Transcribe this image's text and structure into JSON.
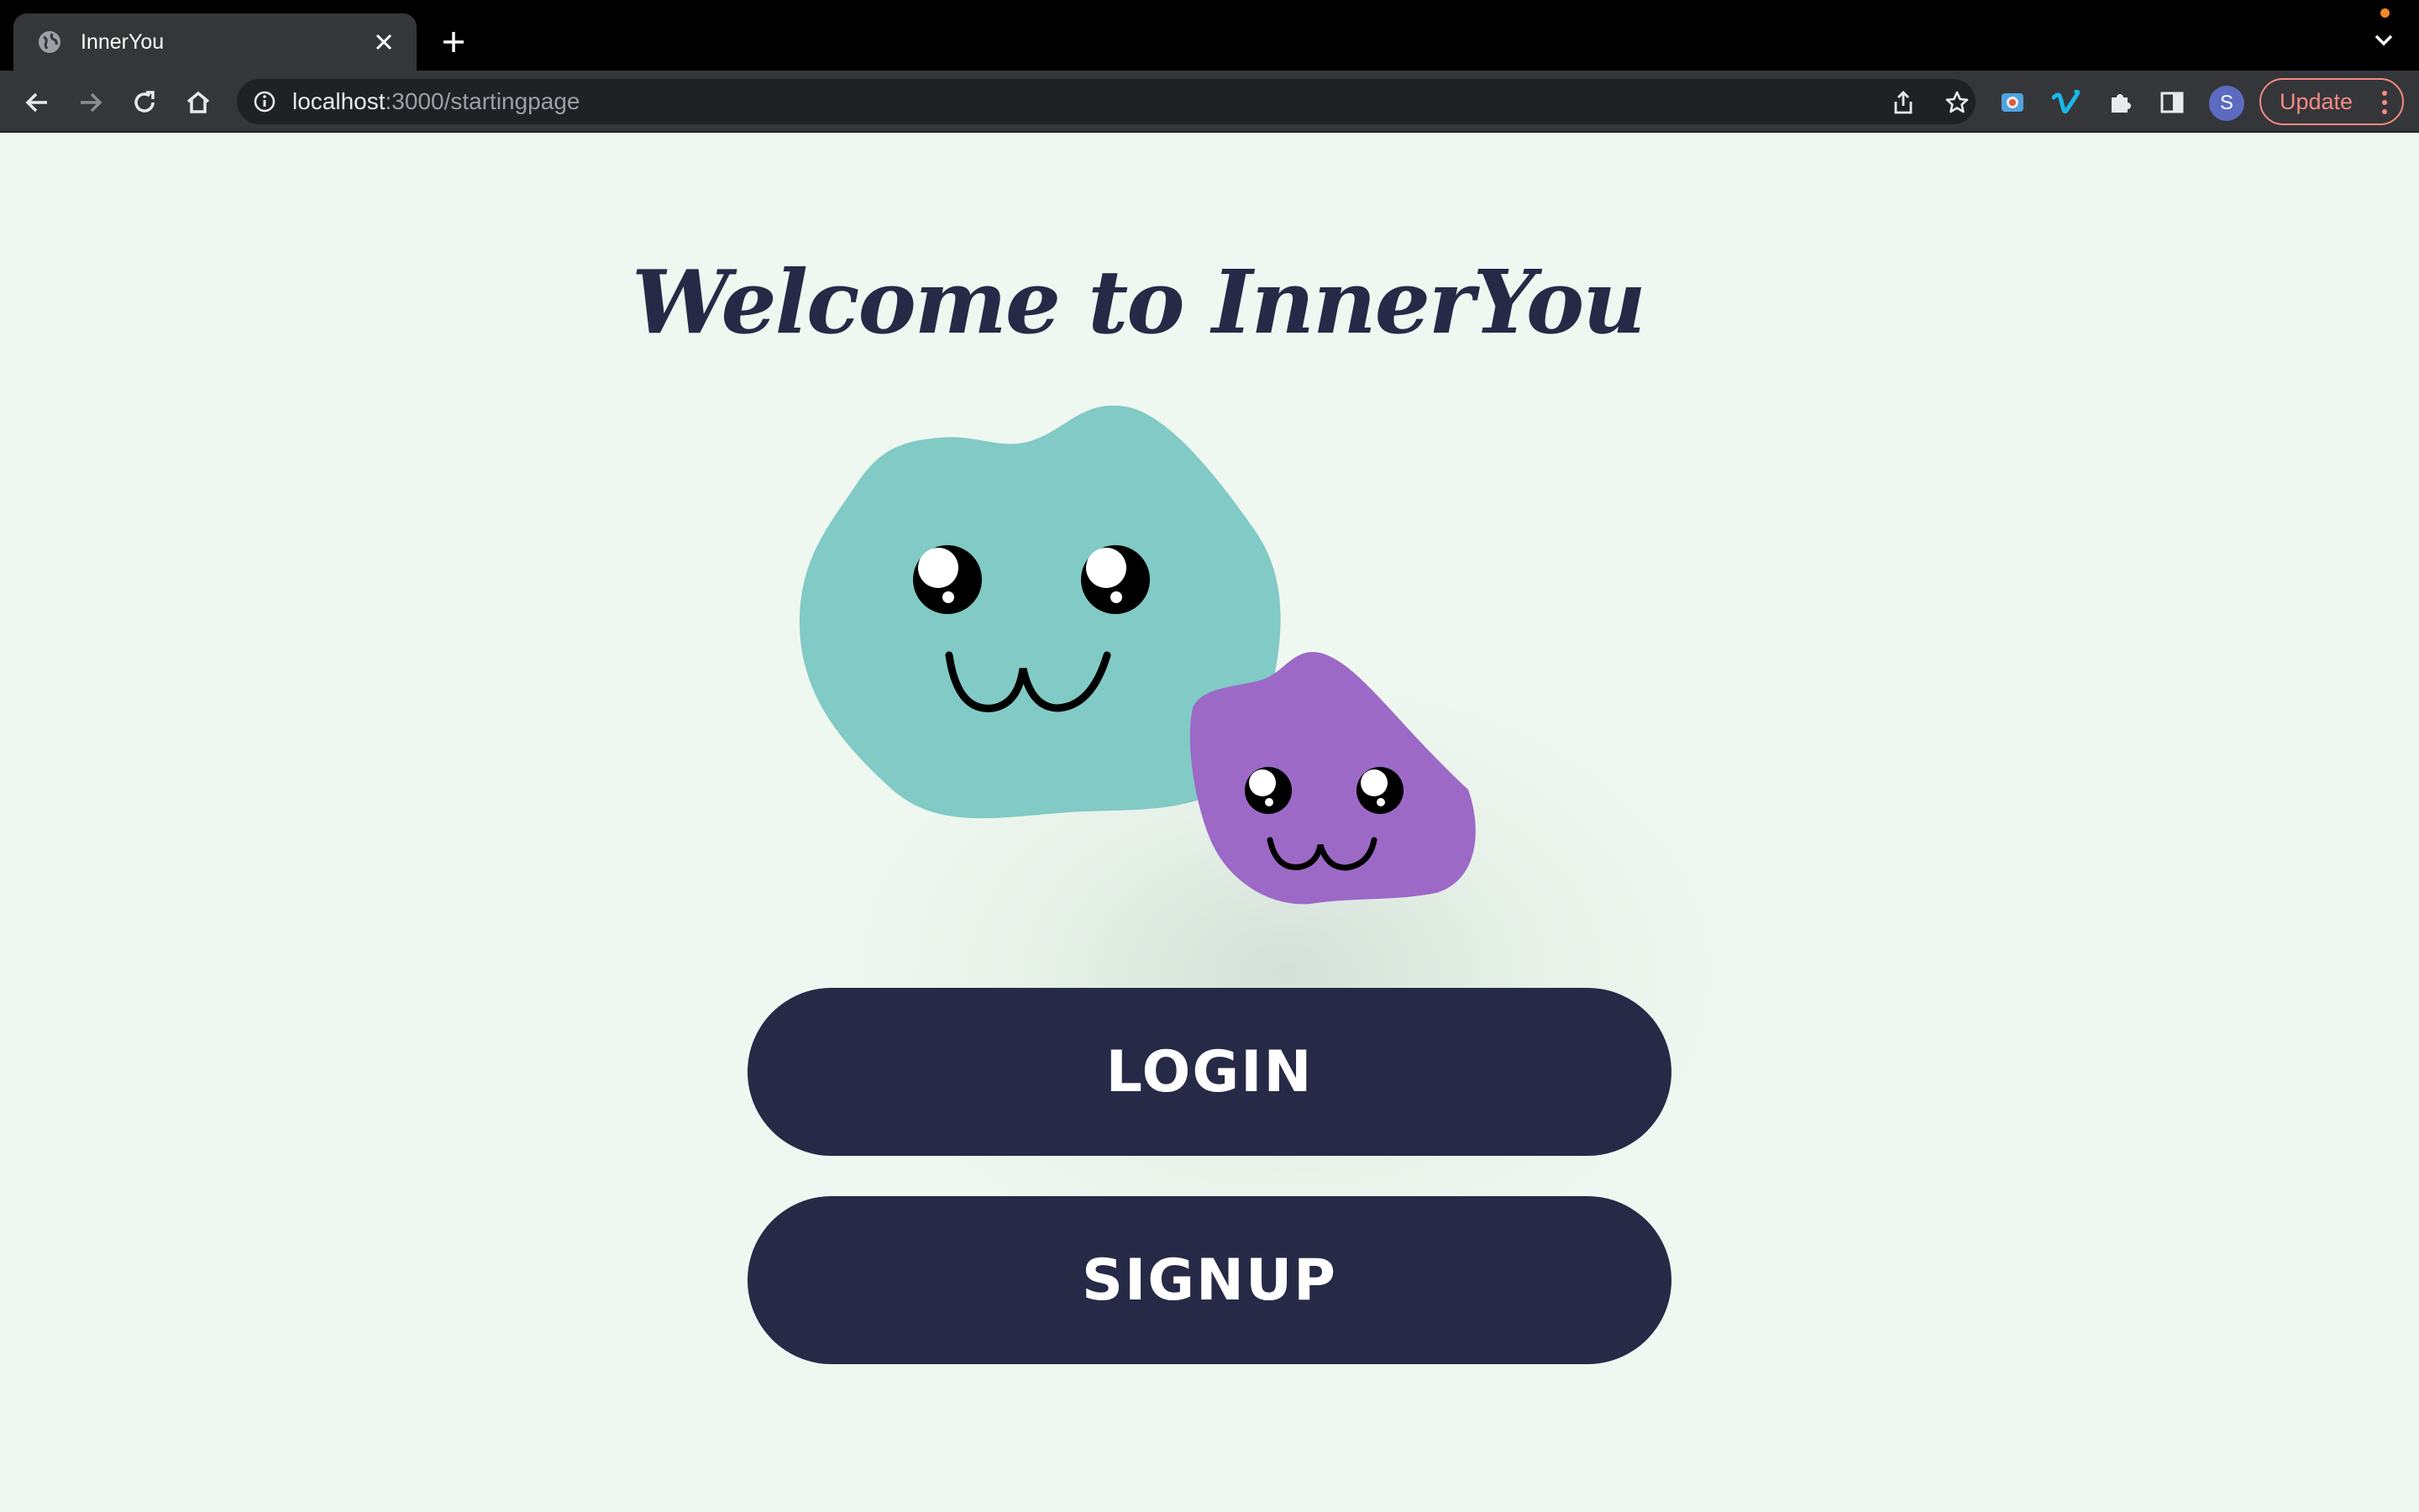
{
  "browser": {
    "tab": {
      "title": "InnerYou"
    },
    "address_bar": {
      "host": "localhost",
      "path": ":3000/startingpage"
    },
    "profile_initial": "S",
    "update_label": "Update"
  },
  "page": {
    "title": "Welcome to InnerYou",
    "login_label": "LOGIN",
    "signup_label": "SIGNUP"
  },
  "colors": {
    "background": "#eff8f0",
    "primary": "#262a47",
    "blob_teal": "#81cac5",
    "blob_purple": "#9c69c7"
  },
  "icons": {
    "favicon": "globe-icon",
    "tab_close": "close-icon",
    "new_tab": "plus-icon",
    "back": "arrow-left-icon",
    "forward": "arrow-right-icon",
    "reload": "reload-icon",
    "home": "home-icon",
    "site_info": "info-icon",
    "share": "share-icon",
    "bookmark": "star-icon",
    "extensions": "puzzle-icon",
    "side_panel": "side-panel-icon",
    "menu": "three-dots-icon"
  }
}
